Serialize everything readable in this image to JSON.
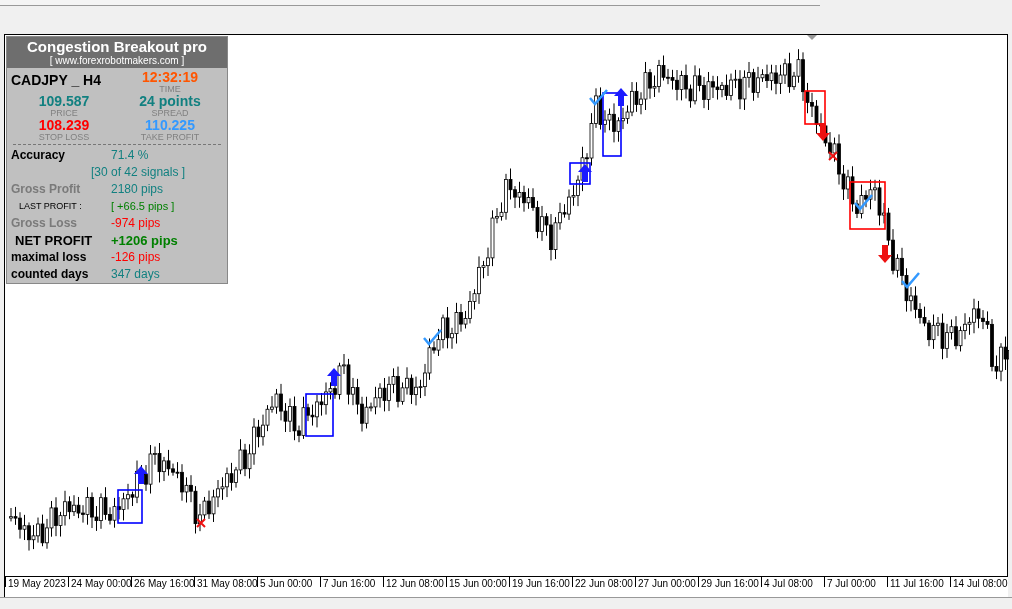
{
  "panel": {
    "title": "Congestion Breakout pro",
    "url": "[ www.forexrobotmakers.com ]",
    "symbol": "CADJPY _ H4",
    "time": "12:32:19",
    "time_label": "TIME",
    "price": "109.587",
    "price_label": "PRICE",
    "spread": "24 points",
    "spread_label": "SPREAD",
    "stop_loss": "108.239",
    "stop_loss_label": "STOP LOSS",
    "take_profit": "110.225",
    "take_profit_label": "TAKE PROFIT",
    "stats": [
      {
        "label": "Accuracy",
        "value": "71.4 %",
        "kind": "strong",
        "color": "#118080"
      },
      {
        "value": "[30 of 42 signals ]",
        "kind": "sub",
        "color": "#118080"
      },
      {
        "label": "Gross Profit",
        "value": "2180 pips",
        "kind": "muted",
        "color": "#118080"
      },
      {
        "label": "LAST PROFIT :",
        "value": "[ +66.5 pips ]",
        "kind": "small",
        "color": "#008000"
      },
      {
        "label": "Gross Loss",
        "value": "-974 pips",
        "kind": "muted",
        "color": "#ff0000"
      },
      {
        "label": "NET PROFIT",
        "value": "+1206 pips",
        "kind": "big",
        "color": "#008000"
      },
      {
        "label": "maximal loss",
        "value": "-126 pips",
        "kind": "strong",
        "color": "#ff0000"
      },
      {
        "label": "counted days",
        "value": "347 days",
        "kind": "strong",
        "color": "#118080"
      }
    ]
  },
  "x_axis": [
    "19 May 2023",
    "24 May 00:00",
    "26 May 16:00",
    "31 May 08:00",
    "5 Jun 00:00",
    "7 Jun 16:00",
    "12 Jun 08:00",
    "15 Jun 00:00",
    "19 Jun 16:00",
    "22 Jun 08:00",
    "27 Jun 00:00",
    "29 Jun 16:00",
    "4 Jul 08:00",
    "7 Jul 00:00",
    "11 Jul 16:00",
    "14 Jul 08:00"
  ]
}
